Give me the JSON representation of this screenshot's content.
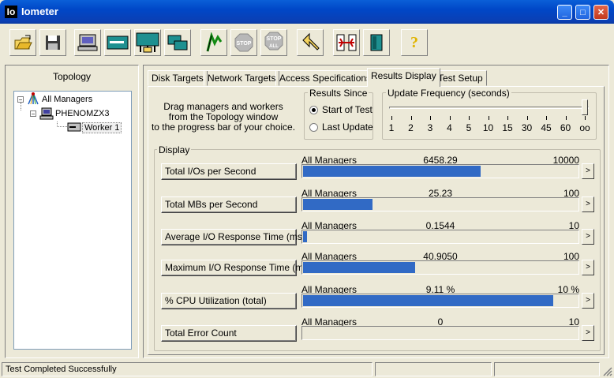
{
  "window": {
    "logo_text": "Io",
    "title": "Iometer",
    "minimize": "_",
    "maximize": "□",
    "close": "✕"
  },
  "toolbar": {
    "buttons": [
      {
        "icon": "open-folder-icon"
      },
      {
        "icon": "save-disk-icon"
      },
      {
        "icon": "display-icon"
      },
      {
        "icon": "new-worker-icon"
      },
      {
        "icon": "network-worker-icon"
      },
      {
        "icon": "duplicate-worker-icon"
      },
      {
        "icon": "start-flag-icon"
      },
      {
        "icon": "stop-icon",
        "label": "STOP"
      },
      {
        "icon": "stop-all-icon",
        "label": "STOP",
        "label2": "ALL"
      },
      {
        "icon": "reset-workers-icon"
      },
      {
        "icon": "disconnect-icon"
      },
      {
        "icon": "exit-icon"
      },
      {
        "icon": "help-icon",
        "label": "?"
      }
    ]
  },
  "topology": {
    "title": "Topology",
    "tree": [
      {
        "label": "All Managers",
        "expander": "−"
      },
      {
        "label": "PHENOMZX3",
        "expander": "−"
      },
      {
        "label": "Worker 1"
      }
    ]
  },
  "tabs": [
    {
      "label": "Disk Targets"
    },
    {
      "label": "Network Targets"
    },
    {
      "label": "Access Specifications"
    },
    {
      "label": "Results Display",
      "active": true
    },
    {
      "label": "Test Setup"
    }
  ],
  "results": {
    "drag_text": [
      "Drag managers and workers",
      "from the Topology window",
      "to the progress bar of your choice."
    ],
    "results_since": {
      "title": "Results Since",
      "options": [
        {
          "label": "Start of Test",
          "checked": true
        },
        {
          "label": "Last Update",
          "checked": false
        }
      ]
    },
    "update_frequency": {
      "title": "Update Frequency (seconds)",
      "ticks": [
        "1",
        "2",
        "3",
        "4",
        "5",
        "10",
        "15",
        "30",
        "45",
        "60",
        "oo"
      ],
      "selected": "oo"
    },
    "display_title": "Display",
    "metrics": [
      {
        "label": "Total I/Os per Second",
        "source": "All Managers",
        "value": "6458.29",
        "max": "10000",
        "fraction": 0.6458
      },
      {
        "label": "Total MBs per Second",
        "source": "All Managers",
        "value": "25.23",
        "max": "100",
        "fraction": 0.2523
      },
      {
        "label": "Average I/O Response Time (ms)",
        "source": "All Managers",
        "value": "0.1544",
        "max": "10",
        "fraction": 0.0154
      },
      {
        "label": "Maximum I/O Response Time (ms)",
        "source": "All Managers",
        "value": "40.9050",
        "max": "100",
        "fraction": 0.409
      },
      {
        "label": "% CPU Utilization (total)",
        "source": "All Managers",
        "value": "9.11 %",
        "max": "10 %",
        "fraction": 0.911
      },
      {
        "label": "Total Error Count",
        "source": "All Managers",
        "value": "0",
        "max": "10",
        "fraction": 0
      }
    ],
    "arrow": ">"
  },
  "statusbar": {
    "message": "Test Completed Successfully"
  }
}
